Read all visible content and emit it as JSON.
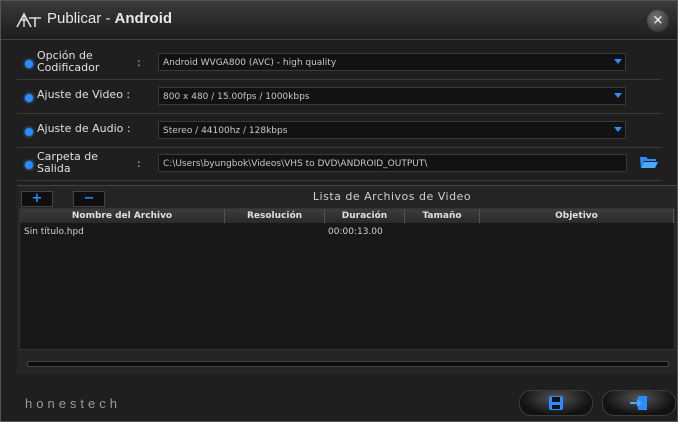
{
  "title": {
    "app": "Publicar",
    "separator": " - ",
    "target": "Android",
    "close_glyph": "×"
  },
  "settings": {
    "encoder": {
      "label_line1": "Opción de",
      "label_line2": "Codificador",
      "value": "Android WVGA800 (AVC) - high quality"
    },
    "video": {
      "label": "Ajuste de Video :",
      "value": "800 x 480 / 15.00fps / 1000kbps"
    },
    "audio": {
      "label": "Ajuste de Audio :",
      "value": "Stereo / 44100hz / 128kbps"
    },
    "output": {
      "label_line1": "Carpeta de",
      "label_line2": "Salida",
      "value": "C:\\Users\\byungbok\\Videos\\VHS to DVD\\ANDROID_OUTPUT\\"
    },
    "colon": ":"
  },
  "file_list": {
    "add_glyph": "+",
    "remove_glyph": "−",
    "title": "Lista de Archivos de Video",
    "columns": [
      "Nombre del Archivo",
      "Resolución",
      "Duración",
      "Tamaño",
      "Objetivo"
    ],
    "rows": [
      {
        "name": "Sin título.hpd",
        "resolution": "",
        "duration": "00:00:13.00",
        "size": "",
        "target": ""
      }
    ]
  },
  "footer": {
    "brand": "honestech"
  },
  "colors": {
    "accent": "#2a8cff",
    "background": "#1f1f1f"
  },
  "icons": [
    "logo-icon",
    "close-icon",
    "dropdown-arrow-icon",
    "folder-open-icon",
    "save-icon",
    "exit-icon"
  ]
}
